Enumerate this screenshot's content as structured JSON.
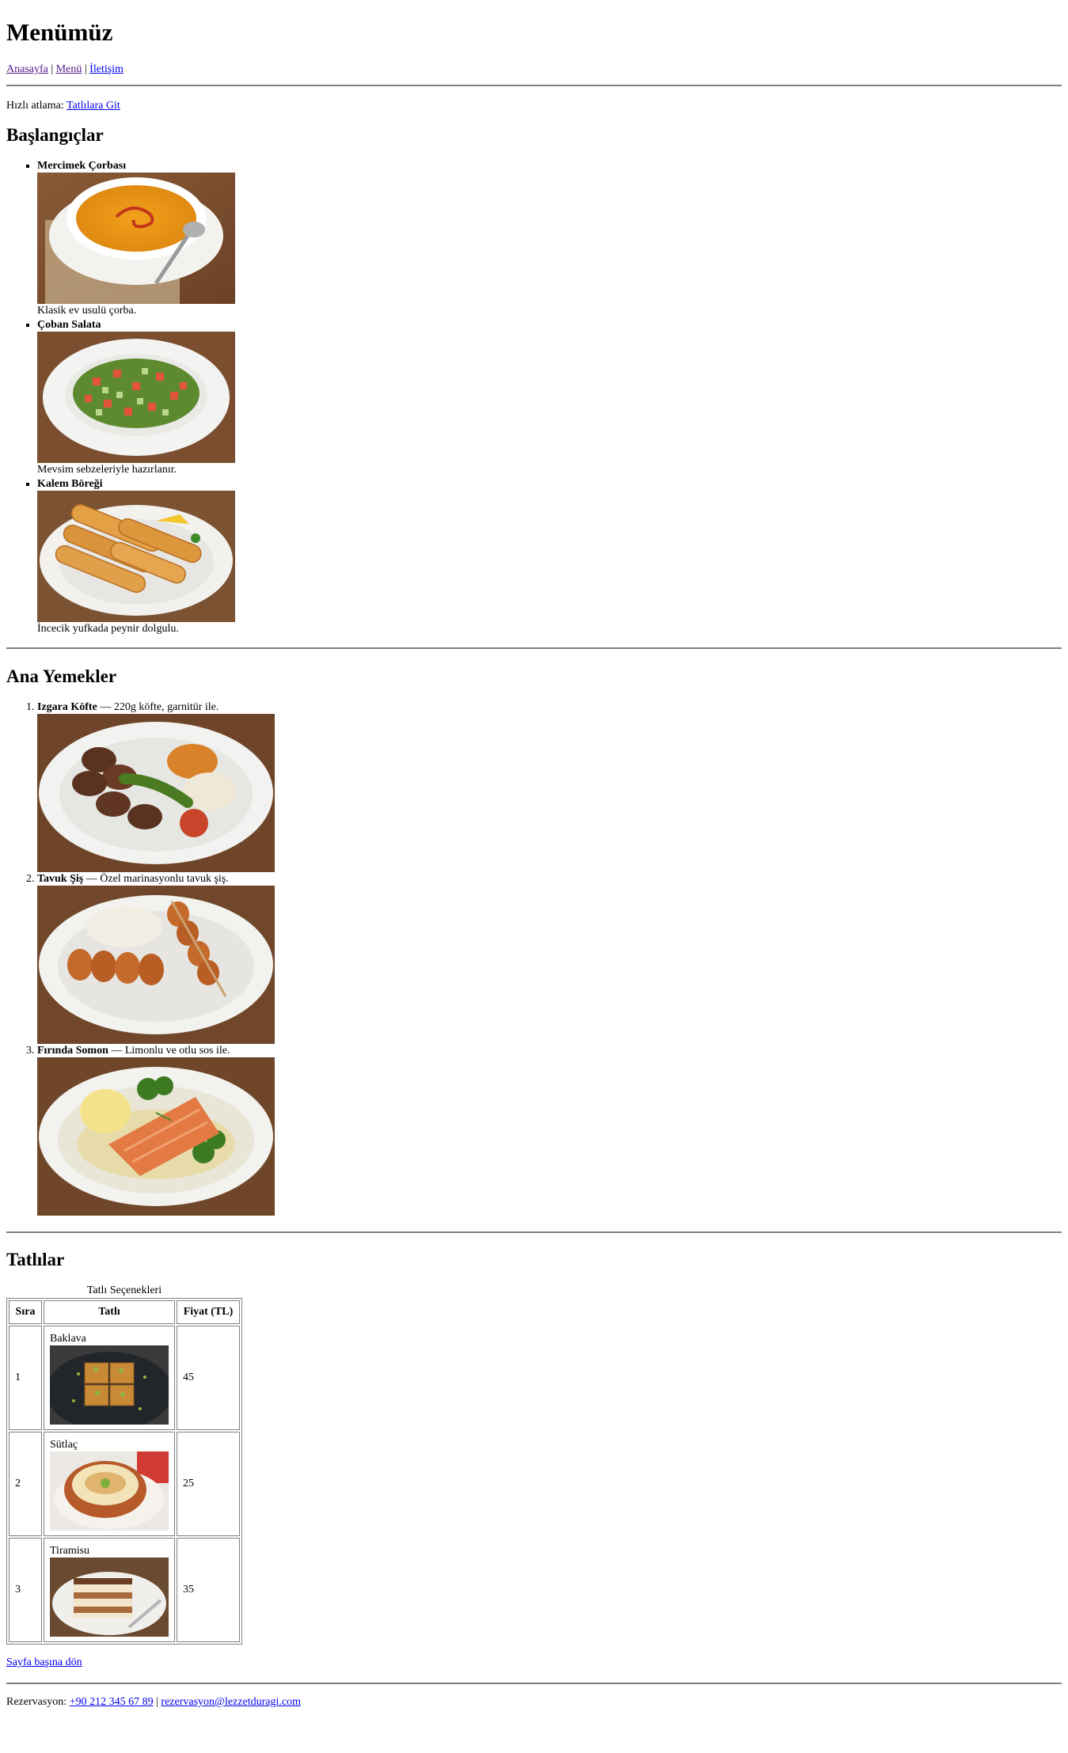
{
  "page": {
    "title": "Menümüz"
  },
  "nav": {
    "home": "Anasayfa",
    "separator1": "|",
    "menu": "Menü",
    "separator2": "|",
    "contact": "İletişim"
  },
  "skip": {
    "label": "Hızlı atlama:",
    "link": "Tatlılara Git"
  },
  "starters": {
    "heading": "Başlangıçlar",
    "items": [
      {
        "name": "Mercimek Çorbası",
        "description": "Klasik ev usulü çorba.",
        "image_alt": "Mercimek Çorbası"
      },
      {
        "name": "Çoban Salata",
        "description": "Mevsim sebzeleriyle hazırlanır.",
        "image_alt": "Çoban Salata"
      },
      {
        "name": "Kalem Böreği",
        "description": "İncecik yufkada peynir dolgulu.",
        "image_alt": "Kalem Böreği"
      }
    ]
  },
  "mains": {
    "heading": "Ana Yemekler",
    "items": [
      {
        "name": "Izgara Köfte",
        "dash": "—",
        "description": "220g köfte, garnitür ile.",
        "image_alt": "Izgara Köfte"
      },
      {
        "name": "Tavuk Şiş",
        "dash": "—",
        "description": "Özel marinasyonlu tavuk şiş.",
        "image_alt": "Tavuk Şiş"
      },
      {
        "name": "Fırında Somon",
        "dash": "—",
        "description": "Limonlu ve otlu sos ile.",
        "image_alt": "Fırında Somon"
      }
    ]
  },
  "desserts": {
    "heading": "Tatlılar",
    "caption": "Tatlı Seçenekleri",
    "columns": [
      "Sıra",
      "Tatlı",
      "Fiyat (TL)"
    ],
    "rows": [
      {
        "order": "1",
        "name": "Baklava",
        "price": "45"
      },
      {
        "order": "2",
        "name": "Sütlaç",
        "price": "25"
      },
      {
        "order": "3",
        "name": "Tiramisu",
        "price": "35"
      }
    ]
  },
  "back_to_top": "Sayfa başına dön",
  "footer": {
    "label": "Rezervasyon:",
    "phone": "+90 212 345 67 89",
    "separator": "|",
    "email": "rezervasyon@lezzetduragi.com"
  }
}
